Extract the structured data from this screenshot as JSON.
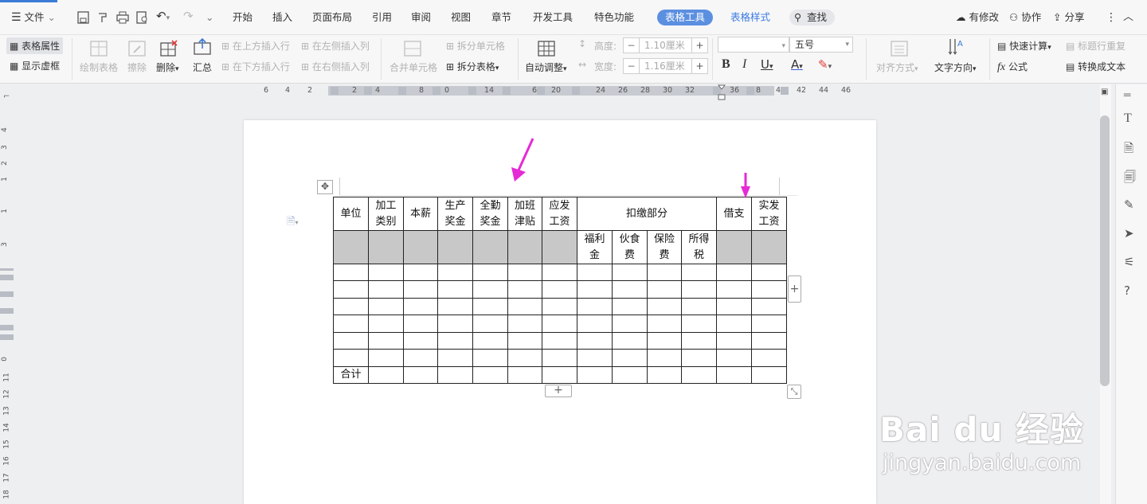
{
  "titlebar": {
    "menu": "文件",
    "tabs": [
      "开始",
      "插入",
      "页面布局",
      "引用",
      "审阅",
      "视图",
      "章节",
      "开发工具",
      "特色功能"
    ],
    "active_tab": "表格工具",
    "style_tab": "表格样式",
    "search": "查找",
    "right": [
      "有修改",
      "协作",
      "分享"
    ]
  },
  "ribbon": {
    "table_props": "表格属性",
    "show_grid": "显示虚框",
    "draw_table": "绘制表格",
    "erase": "擦除",
    "delete": "删除",
    "summary": "汇总",
    "insert_above": "在上方插入行",
    "insert_below": "在下方插入行",
    "insert_left": "在左侧插入列",
    "insert_right": "在右侧插入列",
    "merge": "合并单元格",
    "split_cell": "拆分单元格",
    "split_table": "拆分表格",
    "auto_adjust": "自动调整",
    "height_label": "高度:",
    "height_value": "1.10厘米",
    "width_label": "宽度:",
    "width_value": "1.16厘米",
    "font_size": "五号",
    "align": "对齐方式",
    "text_dir": "文字方向",
    "quick_calc": "快速计算",
    "repeat_header": "标题行重复",
    "formula": "公式",
    "convert": "转换成文本"
  },
  "ruler": {
    "h_ticks": [
      "6",
      "4",
      "2",
      "2",
      "4",
      "8",
      "0",
      "14",
      "6",
      "20",
      "24",
      "26",
      "28",
      "30",
      "32",
      "36",
      "8",
      "4",
      "42",
      "44",
      "46"
    ],
    "v_ticks": [
      "4",
      "3",
      "2",
      "1",
      "1",
      "3",
      "0",
      "11",
      "12",
      "13",
      "14",
      "15",
      "16",
      "17",
      "18"
    ]
  },
  "table": {
    "header1": [
      "单位",
      "加工类别",
      "本薪",
      "生产奖金",
      "全勤奖金",
      "加班津贴",
      "应发工资",
      "扣缴部分",
      "借支",
      "实发工资"
    ],
    "header2": [
      "福利金",
      "伙食费",
      "保险费",
      "所得税"
    ],
    "footer": "合计"
  },
  "watermark": {
    "logo": "Bai du 经验",
    "url": "jingyan.baidu.com"
  },
  "colors": {
    "accent": "#3a7bd5",
    "active_pill": "#5b8fe0",
    "header_fill": "#c8c8c8",
    "arrow": "#e62ad6"
  }
}
